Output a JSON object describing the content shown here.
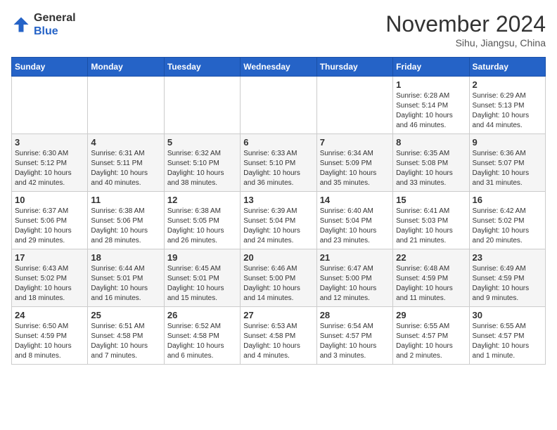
{
  "header": {
    "logo_line1": "General",
    "logo_line2": "Blue",
    "month": "November 2024",
    "location": "Sihu, Jiangsu, China"
  },
  "weekdays": [
    "Sunday",
    "Monday",
    "Tuesday",
    "Wednesday",
    "Thursday",
    "Friday",
    "Saturday"
  ],
  "weeks": [
    [
      {
        "day": "",
        "info": ""
      },
      {
        "day": "",
        "info": ""
      },
      {
        "day": "",
        "info": ""
      },
      {
        "day": "",
        "info": ""
      },
      {
        "day": "",
        "info": ""
      },
      {
        "day": "1",
        "info": "Sunrise: 6:28 AM\nSunset: 5:14 PM\nDaylight: 10 hours\nand 46 minutes."
      },
      {
        "day": "2",
        "info": "Sunrise: 6:29 AM\nSunset: 5:13 PM\nDaylight: 10 hours\nand 44 minutes."
      }
    ],
    [
      {
        "day": "3",
        "info": "Sunrise: 6:30 AM\nSunset: 5:12 PM\nDaylight: 10 hours\nand 42 minutes."
      },
      {
        "day": "4",
        "info": "Sunrise: 6:31 AM\nSunset: 5:11 PM\nDaylight: 10 hours\nand 40 minutes."
      },
      {
        "day": "5",
        "info": "Sunrise: 6:32 AM\nSunset: 5:10 PM\nDaylight: 10 hours\nand 38 minutes."
      },
      {
        "day": "6",
        "info": "Sunrise: 6:33 AM\nSunset: 5:10 PM\nDaylight: 10 hours\nand 36 minutes."
      },
      {
        "day": "7",
        "info": "Sunrise: 6:34 AM\nSunset: 5:09 PM\nDaylight: 10 hours\nand 35 minutes."
      },
      {
        "day": "8",
        "info": "Sunrise: 6:35 AM\nSunset: 5:08 PM\nDaylight: 10 hours\nand 33 minutes."
      },
      {
        "day": "9",
        "info": "Sunrise: 6:36 AM\nSunset: 5:07 PM\nDaylight: 10 hours\nand 31 minutes."
      }
    ],
    [
      {
        "day": "10",
        "info": "Sunrise: 6:37 AM\nSunset: 5:06 PM\nDaylight: 10 hours\nand 29 minutes."
      },
      {
        "day": "11",
        "info": "Sunrise: 6:38 AM\nSunset: 5:06 PM\nDaylight: 10 hours\nand 28 minutes."
      },
      {
        "day": "12",
        "info": "Sunrise: 6:38 AM\nSunset: 5:05 PM\nDaylight: 10 hours\nand 26 minutes."
      },
      {
        "day": "13",
        "info": "Sunrise: 6:39 AM\nSunset: 5:04 PM\nDaylight: 10 hours\nand 24 minutes."
      },
      {
        "day": "14",
        "info": "Sunrise: 6:40 AM\nSunset: 5:04 PM\nDaylight: 10 hours\nand 23 minutes."
      },
      {
        "day": "15",
        "info": "Sunrise: 6:41 AM\nSunset: 5:03 PM\nDaylight: 10 hours\nand 21 minutes."
      },
      {
        "day": "16",
        "info": "Sunrise: 6:42 AM\nSunset: 5:02 PM\nDaylight: 10 hours\nand 20 minutes."
      }
    ],
    [
      {
        "day": "17",
        "info": "Sunrise: 6:43 AM\nSunset: 5:02 PM\nDaylight: 10 hours\nand 18 minutes."
      },
      {
        "day": "18",
        "info": "Sunrise: 6:44 AM\nSunset: 5:01 PM\nDaylight: 10 hours\nand 16 minutes."
      },
      {
        "day": "19",
        "info": "Sunrise: 6:45 AM\nSunset: 5:01 PM\nDaylight: 10 hours\nand 15 minutes."
      },
      {
        "day": "20",
        "info": "Sunrise: 6:46 AM\nSunset: 5:00 PM\nDaylight: 10 hours\nand 14 minutes."
      },
      {
        "day": "21",
        "info": "Sunrise: 6:47 AM\nSunset: 5:00 PM\nDaylight: 10 hours\nand 12 minutes."
      },
      {
        "day": "22",
        "info": "Sunrise: 6:48 AM\nSunset: 4:59 PM\nDaylight: 10 hours\nand 11 minutes."
      },
      {
        "day": "23",
        "info": "Sunrise: 6:49 AM\nSunset: 4:59 PM\nDaylight: 10 hours\nand 9 minutes."
      }
    ],
    [
      {
        "day": "24",
        "info": "Sunrise: 6:50 AM\nSunset: 4:59 PM\nDaylight: 10 hours\nand 8 minutes."
      },
      {
        "day": "25",
        "info": "Sunrise: 6:51 AM\nSunset: 4:58 PM\nDaylight: 10 hours\nand 7 minutes."
      },
      {
        "day": "26",
        "info": "Sunrise: 6:52 AM\nSunset: 4:58 PM\nDaylight: 10 hours\nand 6 minutes."
      },
      {
        "day": "27",
        "info": "Sunrise: 6:53 AM\nSunset: 4:58 PM\nDaylight: 10 hours\nand 4 minutes."
      },
      {
        "day": "28",
        "info": "Sunrise: 6:54 AM\nSunset: 4:57 PM\nDaylight: 10 hours\nand 3 minutes."
      },
      {
        "day": "29",
        "info": "Sunrise: 6:55 AM\nSunset: 4:57 PM\nDaylight: 10 hours\nand 2 minutes."
      },
      {
        "day": "30",
        "info": "Sunrise: 6:55 AM\nSunset: 4:57 PM\nDaylight: 10 hours\nand 1 minute."
      }
    ]
  ]
}
